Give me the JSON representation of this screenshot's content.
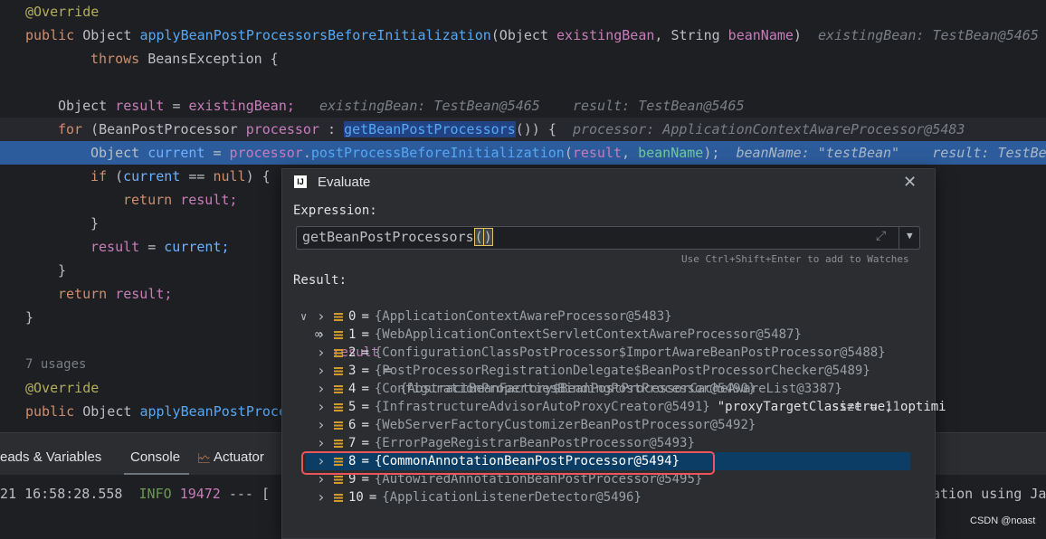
{
  "code": {
    "l1_anno": "@Override",
    "l2_public": "public",
    "l2_type": "Object",
    "l2_method": "applyBeanPostProcessorsBeforeInitialization",
    "l2_open": "(",
    "l2_ptype1": "Object",
    "l2_p1": "existingBean",
    "l2_comma": ",",
    "l2_ptype2": "String",
    "l2_p2": "beanName",
    "l2_close": ")",
    "l2_hint": "existingBean: TestBean@5465",
    "l3_throws": "throws",
    "l3_rest": "BeansException {",
    "l5_type": "Object",
    "l5_var": "result",
    "l5_eq": "=",
    "l5_val": "existingBean;",
    "l5_hint1": "existingBean: TestBean@5465",
    "l5_hint2": "result: TestBean@5465",
    "l6_for": "for",
    "l6_open": "(",
    "l6_type": "BeanPostProcessor",
    "l6_var": "processor",
    "l6_colon": ":",
    "l6_call": "getBeanPostProcessors",
    "l6_end": "()) {",
    "l6_hint": "processor: ApplicationContextAwareProcessor@5483",
    "l7_type": "Object",
    "l7_var": "current",
    "l7_eq": "=",
    "l7_obj": "processor",
    "l7_dot": ".",
    "l7_call": "postProcessBeforeInitialization",
    "l7_open": "(",
    "l7_a1": "result",
    "l7_comma": ",",
    "l7_a2": "beanName",
    "l7_end": ");",
    "l7_hint1": "beanName: \"testBean\"",
    "l7_hint2": "result: TestBe",
    "l8_if": "if",
    "l8_open": "(",
    "l8_var": "current",
    "l8_eq": "==",
    "l8_null": "null",
    "l8_end": ") {",
    "l9_return": "return",
    "l9_var": "result;",
    "l10": "}",
    "l11_var": "result",
    "l11_eq": "=",
    "l11_val": "current;",
    "l12": "}",
    "l13_return": "return",
    "l13_var": "result;",
    "l14": "}",
    "l16_usages": "7 usages",
    "l17_anno": "@Override",
    "l18_public": "public",
    "l18_type": "Object",
    "l18_method": "applyBeanPostProce"
  },
  "tool_window": {
    "tab_threads": "eads & Variables",
    "tab_console": "Console",
    "tab_actuator": "Actuator"
  },
  "console": {
    "l2_ts": "21 16:58:28.558",
    "l2_level": "INFO",
    "l2_pid": "19472",
    "l2_rest": "--- [",
    "l2_tail": "ation using Ja"
  },
  "dialog": {
    "title": "Evaluate",
    "expression_label": "Expression:",
    "expression": "getBeanPostProcessors",
    "expr_paren_open": "(",
    "expr_paren_close": ")",
    "watch_hint": "Use Ctrl+Shift+Enter to add to Watches",
    "result_label": "Result:",
    "result_name": "result",
    "result_eq": "=",
    "result_value": "{AbstractBeanFactory$BeanPostProcessorCacheAwareList@3387}",
    "result_size": "size = 11",
    "items": [
      {
        "index": "0",
        "value": "{ApplicationContextAwareProcessor@5483}"
      },
      {
        "index": "1",
        "value": "{WebApplicationContextServletContextAwareProcessor@5487}"
      },
      {
        "index": "2",
        "value": "{ConfigurationClassPostProcessor$ImportAwareBeanPostProcessor@5488}"
      },
      {
        "index": "3",
        "value": "{PostProcessorRegistrationDelegate$BeanPostProcessorChecker@5489}"
      },
      {
        "index": "4",
        "value": "{ConfigurationPropertiesBindingPostProcessor@5490}"
      },
      {
        "index": "5",
        "value": "{InfrastructureAdvisorAutoProxyCreator@5491}",
        "extra": "\"proxyTargetClass=true; optimi"
      },
      {
        "index": "6",
        "value": "{WebServerFactoryCustomizerBeanPostProcessor@5492}"
      },
      {
        "index": "7",
        "value": "{ErrorPageRegistrarBeanPostProcessor@5493}"
      },
      {
        "index": "8",
        "value": "{CommonAnnotationBeanPostProcessor@5494}"
      },
      {
        "index": "9",
        "value": "{AutowiredAnnotationBeanPostProcessor@5495}"
      },
      {
        "index": "10",
        "value": "{ApplicationListenerDetector@5496}"
      }
    ],
    "eq": "="
  },
  "watermark": "CSDN @noast"
}
